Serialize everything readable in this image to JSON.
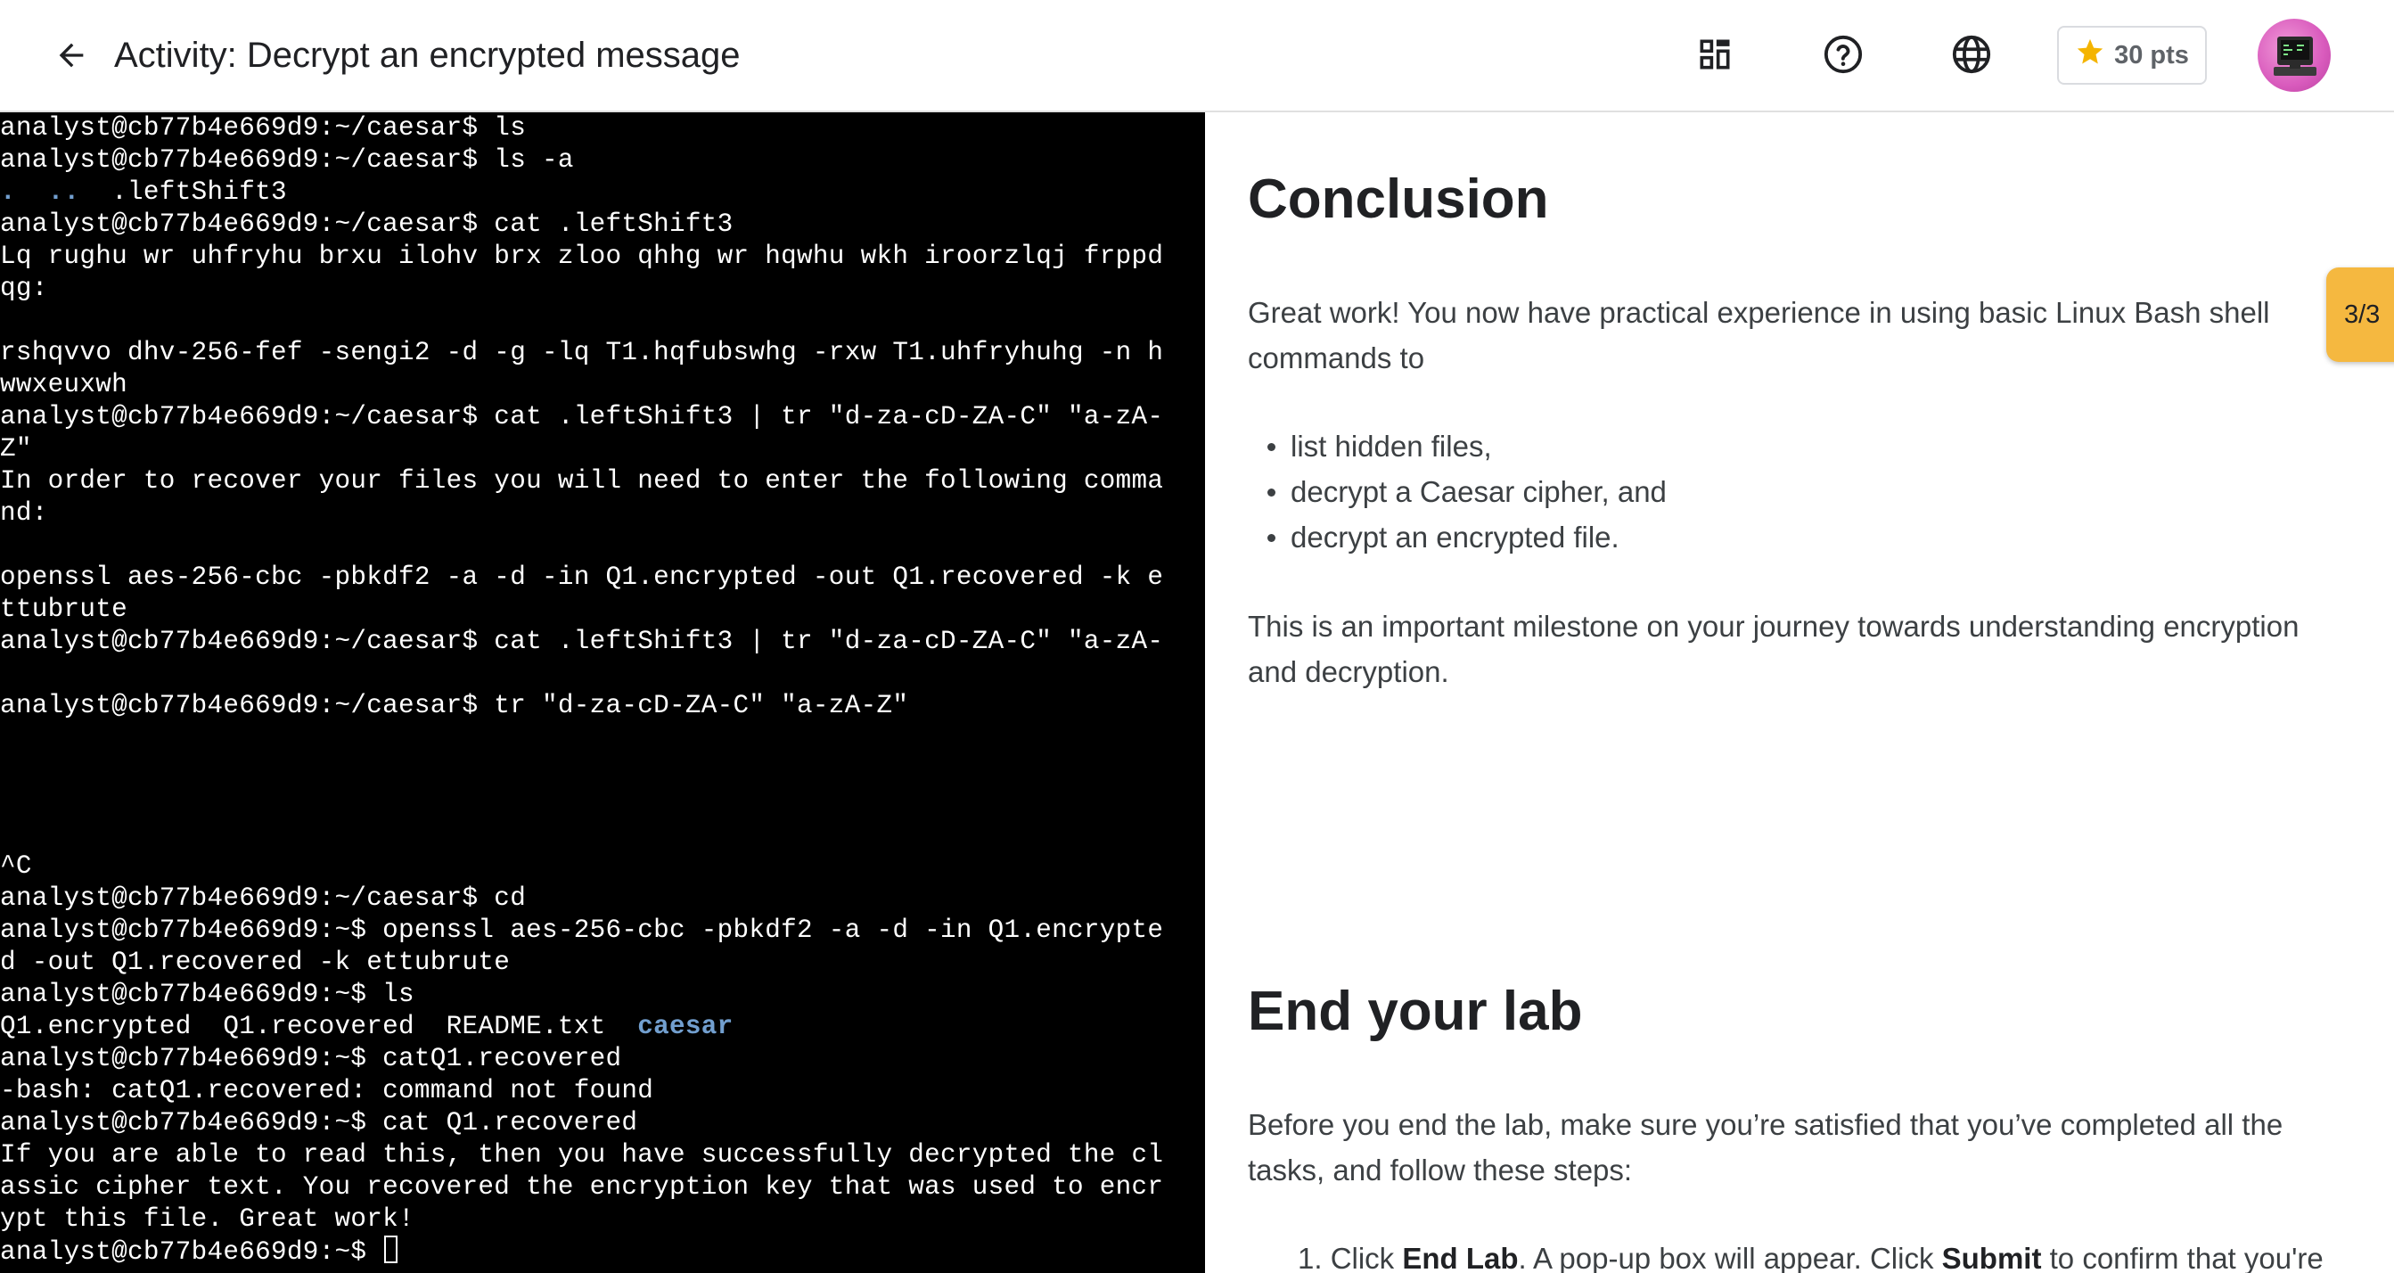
{
  "header": {
    "back_icon": "arrow-back-icon",
    "title": "Activity: Decrypt an encrypted message",
    "icons": [
      "dashboard-icon",
      "help-icon",
      "language-icon"
    ],
    "points_label": "30 pts",
    "points_icon": "star-icon",
    "star_color": "#f4b400"
  },
  "terminal": {
    "lines": [
      "analyst@cb77b4e669d9:~/caesar$ ls",
      "analyst@cb77b4e669d9:~/caesar$ ls -a",
      "__DIRLINE__",
      "analyst@cb77b4e669d9:~/caesar$ cat .leftShift3",
      "Lq rughu wr uhfryhu brxu ilohv brx zloo qhhg wr hqwhu wkh iroorzlqj frppd",
      "qg:",
      "",
      "rshqvvo dhv-256-fef -sengi2 -d -g -lq T1.hqfubswhg -rxw T1.uhfryhuhg -n h",
      "wwxeuxwh",
      "analyst@cb77b4e669d9:~/caesar$ cat .leftShift3 | tr \"d-za-cD-ZA-C\" \"a-zA-",
      "Z\"",
      "In order to recover your files you will need to enter the following comma",
      "nd:",
      "",
      "openssl aes-256-cbc -pbkdf2 -a -d -in Q1.encrypted -out Q1.recovered -k e",
      "ttubrute",
      "analyst@cb77b4e669d9:~/caesar$ cat .leftShift3 | tr \"d-za-cD-ZA-C\" \"a-zA-",
      "",
      "analyst@cb77b4e669d9:~/caesar$ tr \"d-za-cD-ZA-C\" \"a-zA-Z\"",
      "",
      "",
      "",
      "",
      "^C",
      "analyst@cb77b4e669d9:~/caesar$ cd",
      "analyst@cb77b4e669d9:~$ openssl aes-256-cbc -pbkdf2 -a -d -in Q1.encrypte",
      "d -out Q1.recovered -k ettubrute",
      "analyst@cb77b4e669d9:~$ ls",
      "__LSLINE__",
      "analyst@cb77b4e669d9:~$ catQ1.recovered",
      "-bash: catQ1.recovered: command not found",
      "analyst@cb77b4e669d9:~$ cat Q1.recovered",
      "If you are able to read this, then you have successfully decrypted the cl",
      "assic cipher text. You recovered the encryption key that was used to encr",
      "ypt this file. Great work!",
      "__PROMPTLINE__"
    ],
    "ls_a_dirs": ".  ..",
    "ls_a_file": "  .leftShift3",
    "ls_files": "Q1.encrypted  Q1.recovered  README.txt  ",
    "ls_dir": "caesar",
    "prompt": "analyst@cb77b4e669d9:~$ ",
    "dir_color": "#729fcf"
  },
  "content": {
    "conclusion_heading": "Conclusion",
    "conclusion_para": "Great work! You now have practical experience in using basic Linux Bash shell commands to",
    "bullets": [
      "list hidden files,",
      "decrypt a Caesar cipher, and",
      "decrypt an encrypted file."
    ],
    "milestone_para": "This is an important milestone on your journey towards understanding encryption and decryption.",
    "end_heading": "End your lab",
    "end_para": "Before you end the lab, make sure you’re satisfied that you’ve completed all the tasks, and follow these steps:",
    "step1_num": "1. Click ",
    "step1_bold1": "End Lab",
    "step1_mid": ". A pop-up box will appear. Click ",
    "step1_bold2": "Submit",
    "step1_end": " to confirm that you're"
  },
  "progress": {
    "label": "3/3",
    "color": "#f5b840"
  }
}
